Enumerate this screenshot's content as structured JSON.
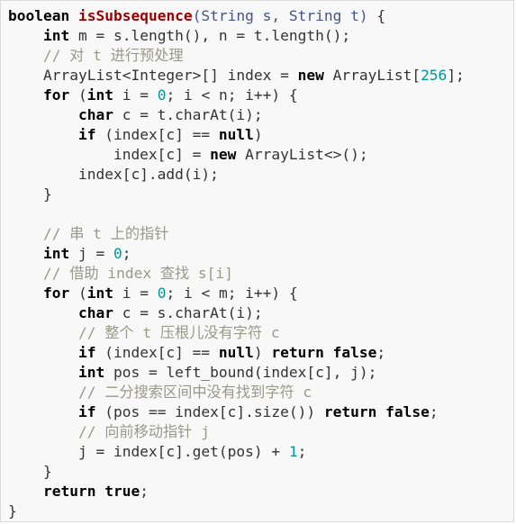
{
  "colors": {
    "background": "#f8f8f8",
    "border": "#dcdcdc",
    "keyword": "#000000",
    "function_name": "#990000",
    "type": "#445588",
    "comment": "#999988",
    "number": "#009999",
    "plain": "#333333"
  },
  "code": {
    "lines": [
      [
        {
          "t": "k",
          "s": "boolean"
        },
        {
          "t": "p",
          "s": " "
        },
        {
          "t": "f",
          "s": "isSubsequence"
        },
        {
          "t": "t",
          "s": "(String s, String t)"
        },
        {
          "t": "p",
          "s": " {"
        }
      ],
      [
        {
          "t": "p",
          "s": "    "
        },
        {
          "t": "k",
          "s": "int"
        },
        {
          "t": "p",
          "s": " m = s.length(), n = t.length();"
        }
      ],
      [
        {
          "t": "p",
          "s": "    "
        },
        {
          "t": "c",
          "s": "// 对 t 进行预处理"
        }
      ],
      [
        {
          "t": "p",
          "s": "    ArrayList<Integer>[] index = "
        },
        {
          "t": "k",
          "s": "new"
        },
        {
          "t": "p",
          "s": " ArrayList["
        },
        {
          "t": "n",
          "s": "256"
        },
        {
          "t": "p",
          "s": "];"
        }
      ],
      [
        {
          "t": "p",
          "s": "    "
        },
        {
          "t": "k",
          "s": "for"
        },
        {
          "t": "p",
          "s": " ("
        },
        {
          "t": "k",
          "s": "int"
        },
        {
          "t": "p",
          "s": " i = "
        },
        {
          "t": "n",
          "s": "0"
        },
        {
          "t": "p",
          "s": "; i < n; i++) {"
        }
      ],
      [
        {
          "t": "p",
          "s": "        "
        },
        {
          "t": "k",
          "s": "char"
        },
        {
          "t": "p",
          "s": " c = t.charAt(i);"
        }
      ],
      [
        {
          "t": "p",
          "s": "        "
        },
        {
          "t": "k",
          "s": "if"
        },
        {
          "t": "p",
          "s": " (index[c] == "
        },
        {
          "t": "k",
          "s": "null"
        },
        {
          "t": "p",
          "s": ")"
        }
      ],
      [
        {
          "t": "p",
          "s": "            index[c] = "
        },
        {
          "t": "k",
          "s": "new"
        },
        {
          "t": "p",
          "s": " ArrayList<>();"
        }
      ],
      [
        {
          "t": "p",
          "s": "        index[c].add(i);"
        }
      ],
      [
        {
          "t": "p",
          "s": "    }"
        }
      ],
      [],
      [
        {
          "t": "p",
          "s": "    "
        },
        {
          "t": "c",
          "s": "// 串 t 上的指针"
        }
      ],
      [
        {
          "t": "p",
          "s": "    "
        },
        {
          "t": "k",
          "s": "int"
        },
        {
          "t": "p",
          "s": " j = "
        },
        {
          "t": "n",
          "s": "0"
        },
        {
          "t": "p",
          "s": ";"
        }
      ],
      [
        {
          "t": "p",
          "s": "    "
        },
        {
          "t": "c",
          "s": "// 借助 index 查找 s[i]"
        }
      ],
      [
        {
          "t": "p",
          "s": "    "
        },
        {
          "t": "k",
          "s": "for"
        },
        {
          "t": "p",
          "s": " ("
        },
        {
          "t": "k",
          "s": "int"
        },
        {
          "t": "p",
          "s": " i = "
        },
        {
          "t": "n",
          "s": "0"
        },
        {
          "t": "p",
          "s": "; i < m; i++) {"
        }
      ],
      [
        {
          "t": "p",
          "s": "        "
        },
        {
          "t": "k",
          "s": "char"
        },
        {
          "t": "p",
          "s": " c = s.charAt(i);"
        }
      ],
      [
        {
          "t": "p",
          "s": "        "
        },
        {
          "t": "c",
          "s": "// 整个 t 压根儿没有字符 c"
        }
      ],
      [
        {
          "t": "p",
          "s": "        "
        },
        {
          "t": "k",
          "s": "if"
        },
        {
          "t": "p",
          "s": " (index[c] == "
        },
        {
          "t": "k",
          "s": "null"
        },
        {
          "t": "p",
          "s": ") "
        },
        {
          "t": "k",
          "s": "return"
        },
        {
          "t": "p",
          "s": " "
        },
        {
          "t": "k",
          "s": "false"
        },
        {
          "t": "p",
          "s": ";"
        }
      ],
      [
        {
          "t": "p",
          "s": "        "
        },
        {
          "t": "k",
          "s": "int"
        },
        {
          "t": "p",
          "s": " pos = left_bound(index[c], j);"
        }
      ],
      [
        {
          "t": "p",
          "s": "        "
        },
        {
          "t": "c",
          "s": "// 二分搜索区间中没有找到字符 c"
        }
      ],
      [
        {
          "t": "p",
          "s": "        "
        },
        {
          "t": "k",
          "s": "if"
        },
        {
          "t": "p",
          "s": " (pos == index[c].size()) "
        },
        {
          "t": "k",
          "s": "return"
        },
        {
          "t": "p",
          "s": " "
        },
        {
          "t": "k",
          "s": "false"
        },
        {
          "t": "p",
          "s": ";"
        }
      ],
      [
        {
          "t": "p",
          "s": "        "
        },
        {
          "t": "c",
          "s": "// 向前移动指针 j"
        }
      ],
      [
        {
          "t": "p",
          "s": "        j = index[c].get(pos) + "
        },
        {
          "t": "n",
          "s": "1"
        },
        {
          "t": "p",
          "s": ";"
        }
      ],
      [
        {
          "t": "p",
          "s": "    }"
        }
      ],
      [
        {
          "t": "p",
          "s": "    "
        },
        {
          "t": "k",
          "s": "return"
        },
        {
          "t": "p",
          "s": " "
        },
        {
          "t": "k",
          "s": "true"
        },
        {
          "t": "p",
          "s": ";"
        }
      ],
      [
        {
          "t": "p",
          "s": "}"
        }
      ]
    ]
  }
}
